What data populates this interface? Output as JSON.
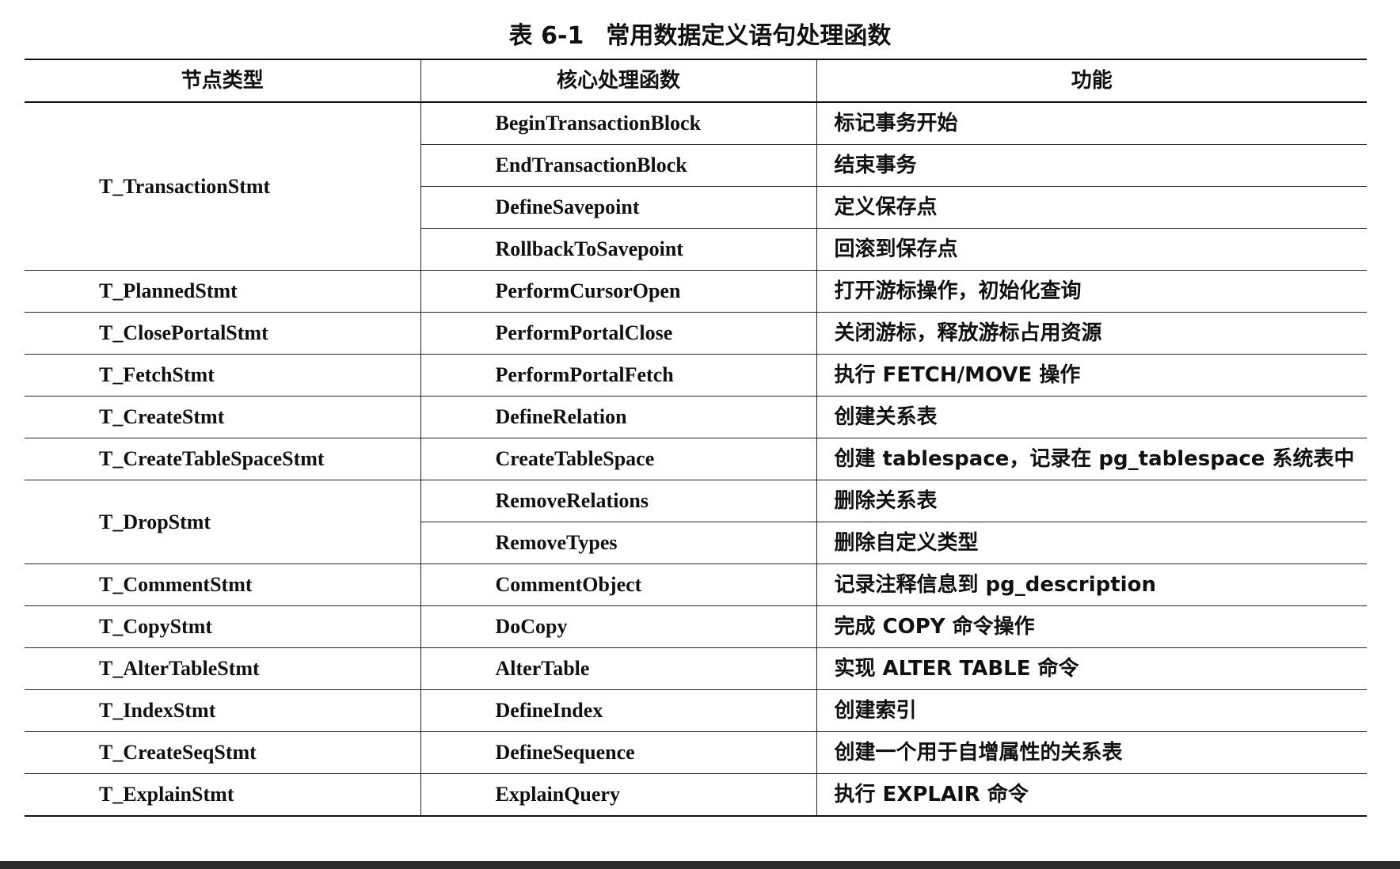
{
  "caption": {
    "number": "表 6-1",
    "title": "常用数据定义语句处理函数"
  },
  "table": {
    "headers": [
      "节点类型",
      "核心处理函数",
      "功能"
    ],
    "groups": [
      {
        "node": "T_TransactionStmt",
        "entries": [
          {
            "func": "BeginTransactionBlock",
            "desc": "标记事务开始"
          },
          {
            "func": "EndTransactionBlock",
            "desc": "结束事务"
          },
          {
            "func": "DefineSavepoint",
            "desc": "定义保存点"
          },
          {
            "func": "RollbackToSavepoint",
            "desc": "回滚到保存点"
          }
        ]
      },
      {
        "node": "T_PlannedStmt",
        "entries": [
          {
            "func": "PerformCursorOpen",
            "desc": "打开游标操作，初始化查询"
          }
        ]
      },
      {
        "node": "T_ClosePortalStmt",
        "entries": [
          {
            "func": "PerformPortalClose",
            "desc": "关闭游标，释放游标占用资源"
          }
        ]
      },
      {
        "node": "T_FetchStmt",
        "entries": [
          {
            "func": "PerformPortalFetch",
            "desc": "执行 FETCH/MOVE 操作"
          }
        ]
      },
      {
        "node": "T_CreateStmt",
        "entries": [
          {
            "func": "DefineRelation",
            "desc": "创建关系表"
          }
        ]
      },
      {
        "node": "T_CreateTableSpaceStmt",
        "entries": [
          {
            "func": "CreateTableSpace",
            "desc": "创建 tablespace，记录在 pg_tablespace 系统表中"
          }
        ]
      },
      {
        "node": "T_DropStmt",
        "entries": [
          {
            "func": "RemoveRelations",
            "desc": "删除关系表"
          },
          {
            "func": "RemoveTypes",
            "desc": "删除自定义类型"
          }
        ]
      },
      {
        "node": "T_CommentStmt",
        "entries": [
          {
            "func": "CommentObject",
            "desc": "记录注释信息到 pg_description"
          }
        ]
      },
      {
        "node": "T_CopyStmt",
        "entries": [
          {
            "func": "DoCopy",
            "desc": "完成 COPY 命令操作"
          }
        ]
      },
      {
        "node": "T_AlterTableStmt",
        "entries": [
          {
            "func": "AlterTable",
            "desc": "实现 ALTER TABLE 命令"
          }
        ]
      },
      {
        "node": "T_IndexStmt",
        "entries": [
          {
            "func": "DefineIndex",
            "desc": "创建索引"
          }
        ]
      },
      {
        "node": "T_CreateSeqStmt",
        "entries": [
          {
            "func": "DefineSequence",
            "desc": "创建一个用于自增属性的关系表"
          }
        ]
      },
      {
        "node": "T_ExplainStmt",
        "entries": [
          {
            "func": "ExplainQuery",
            "desc": "执行 EXPLAIR 命令"
          }
        ]
      }
    ]
  }
}
